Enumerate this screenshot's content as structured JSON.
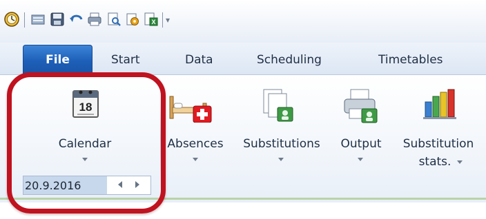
{
  "quick_access": {
    "items": [
      "app-clock-icon",
      "open-icon",
      "save-icon",
      "undo-icon",
      "print-icon",
      "print-preview-icon",
      "settings-icon",
      "excel-export-icon"
    ],
    "more": "▾"
  },
  "tabs": {
    "file": "File",
    "start": "Start",
    "data": "Data",
    "scheduling": "Scheduling",
    "timetables": "Timetables"
  },
  "ribbon": {
    "calendar": {
      "label": "Calendar",
      "icon": "calendar-icon",
      "day": "18"
    },
    "absences": {
      "label": "Absences",
      "icon": "absences-bed-icon"
    },
    "substitutions": {
      "label": "Substitutions",
      "icon": "substitutions-icon"
    },
    "output": {
      "label": "Output",
      "icon": "output-printer-icon"
    },
    "substitution_stats": {
      "label_line1": "Substitution",
      "label_line2": "stats.",
      "icon": "bar-chart-icon"
    }
  },
  "date_field": {
    "value": "20.9.2016"
  },
  "colors": {
    "file_tab": "#1d5fb8",
    "highlight": "#c0121f",
    "selection": "#c8d8ec"
  }
}
